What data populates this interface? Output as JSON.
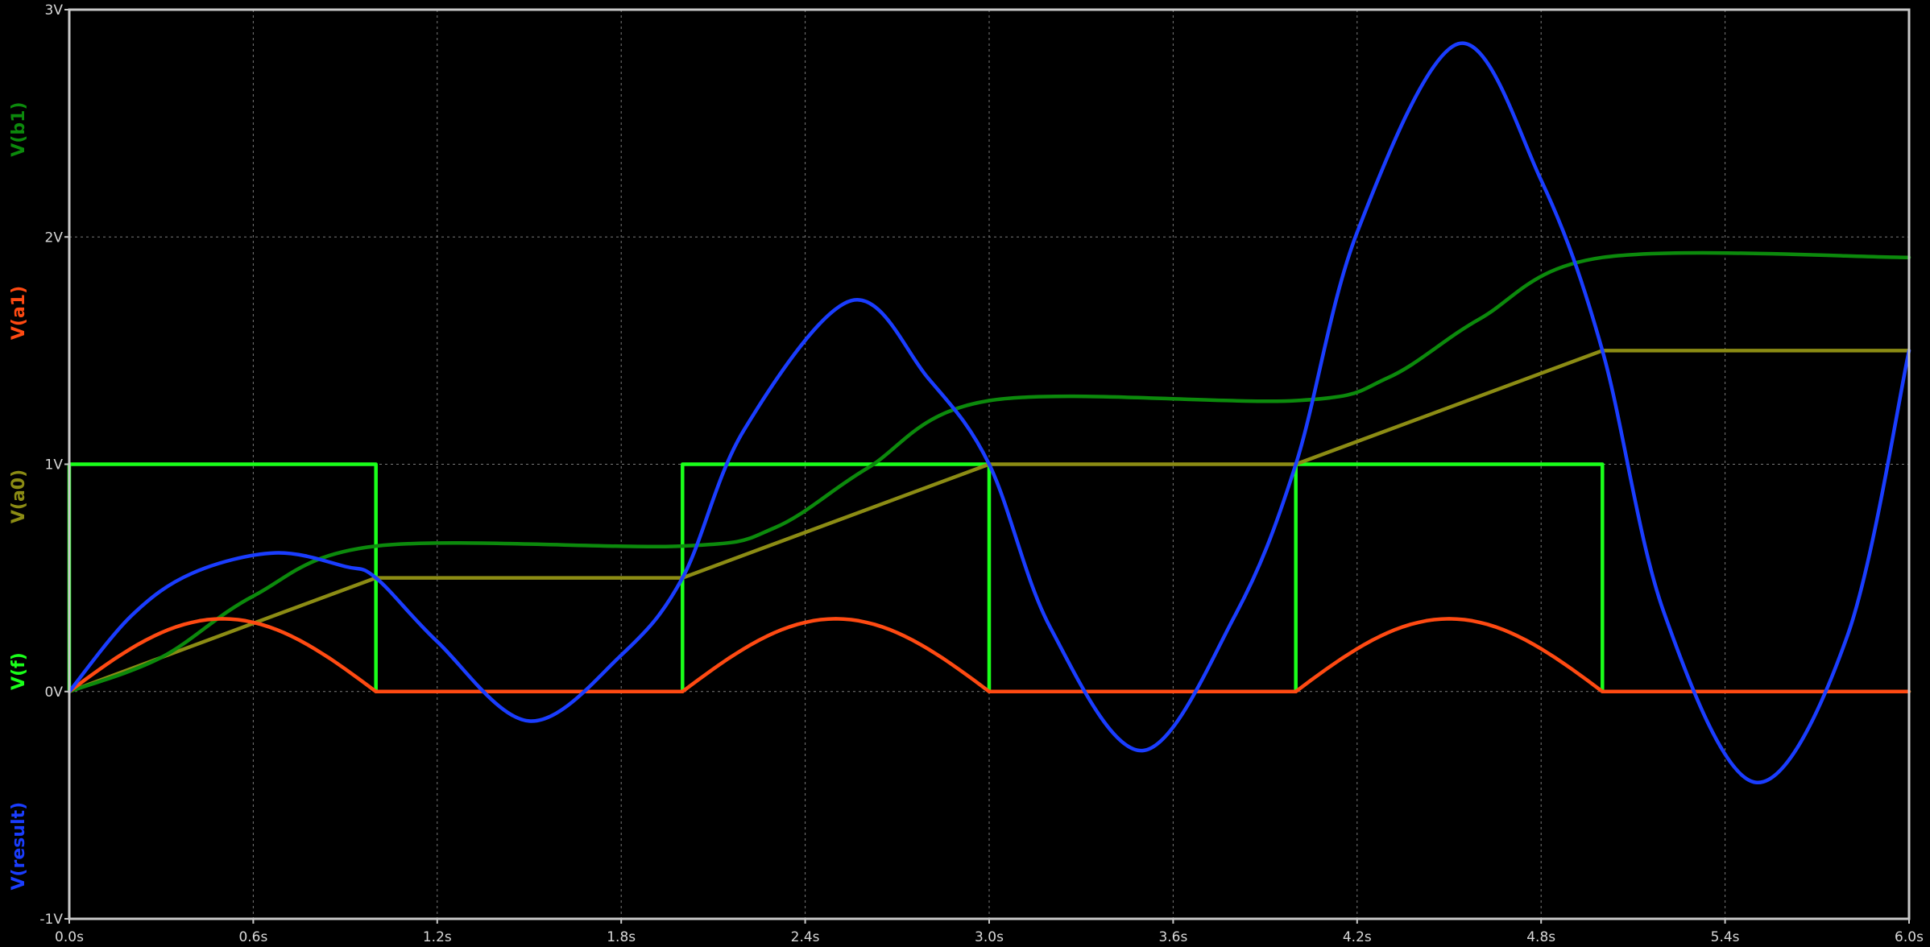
{
  "chart_data": {
    "type": "line",
    "xlim": [
      0,
      6
    ],
    "ylim": [
      -1,
      3
    ],
    "grid": true,
    "legend": "left-vertical",
    "x_ticks": [
      "0.0s",
      "0.6s",
      "1.2s",
      "1.8s",
      "2.4s",
      "3.0s",
      "3.6s",
      "4.2s",
      "4.8s",
      "5.4s",
      "6.0s"
    ],
    "y_ticks": [
      "-1V",
      "0V",
      "1V",
      "2V",
      "3V"
    ],
    "colors": {
      "background": "#000000",
      "frame": "#c8c8c8",
      "grid": "#7a7a7a"
    },
    "series": [
      {
        "name": "V(result)",
        "color": "#1a3dff",
        "x": [
          0,
          0.2,
          0.4,
          0.67,
          0.9,
          1.0,
          1.2,
          1.5,
          1.8,
          2.0,
          2.2,
          2.55,
          2.8,
          3.0,
          3.2,
          3.5,
          3.8,
          4.0,
          4.2,
          4.53,
          4.8,
          5.0,
          5.2,
          5.5,
          5.8,
          6.0
        ],
        "y": [
          0,
          0.33,
          0.52,
          0.61,
          0.55,
          0.5,
          0.22,
          -0.13,
          0.16,
          0.5,
          1.15,
          1.72,
          1.38,
          1.0,
          0.28,
          -0.26,
          0.33,
          1.0,
          2.02,
          2.85,
          2.25,
          1.5,
          0.35,
          -0.4,
          0.25,
          1.5
        ]
      },
      {
        "name": "V(b1)",
        "color": "#0c8a0c",
        "x": [
          0,
          0.3,
          0.6,
          1.0,
          2.0,
          2.3,
          2.6,
          3.0,
          4.0,
          4.3,
          4.6,
          5.0,
          6.0
        ],
        "y": [
          0,
          0.15,
          0.42,
          0.64,
          0.64,
          0.72,
          0.98,
          1.28,
          1.28,
          1.38,
          1.64,
          1.91,
          1.91
        ]
      },
      {
        "name": "V(a1)",
        "color": "#ff4a12",
        "x": [
          0,
          0.25,
          0.5,
          0.75,
          1.0,
          2.0,
          2.25,
          2.5,
          2.75,
          3.0,
          4.0,
          4.25,
          4.5,
          4.75,
          5.0,
          6.0
        ],
        "y": [
          0,
          0.22,
          0.32,
          0.22,
          0,
          0,
          0.22,
          0.32,
          0.22,
          0,
          0,
          0.22,
          0.32,
          0.22,
          0,
          0
        ]
      },
      {
        "name": "V(a0)",
        "color": "#8c8c14",
        "x": [
          0,
          1.0,
          2.0,
          3.0,
          4.0,
          5.0,
          6.0
        ],
        "y": [
          0,
          0.5,
          0.5,
          1.0,
          1.0,
          1.5,
          1.5
        ]
      },
      {
        "name": "V(f)",
        "color": "#1aff1a",
        "x": [
          0,
          0,
          1.0,
          1.0,
          2.0,
          2.0,
          3.0,
          3.0,
          4.0,
          4.0,
          5.0,
          5.0,
          6.0
        ],
        "y": [
          0,
          1,
          1,
          0,
          0,
          1,
          1,
          0,
          0,
          1,
          1,
          0,
          0
        ]
      }
    ],
    "label_order_top_to_bottom": [
      "V(b1)",
      "V(a1)",
      "V(a0)",
      "V(f)",
      "V(result)"
    ]
  }
}
